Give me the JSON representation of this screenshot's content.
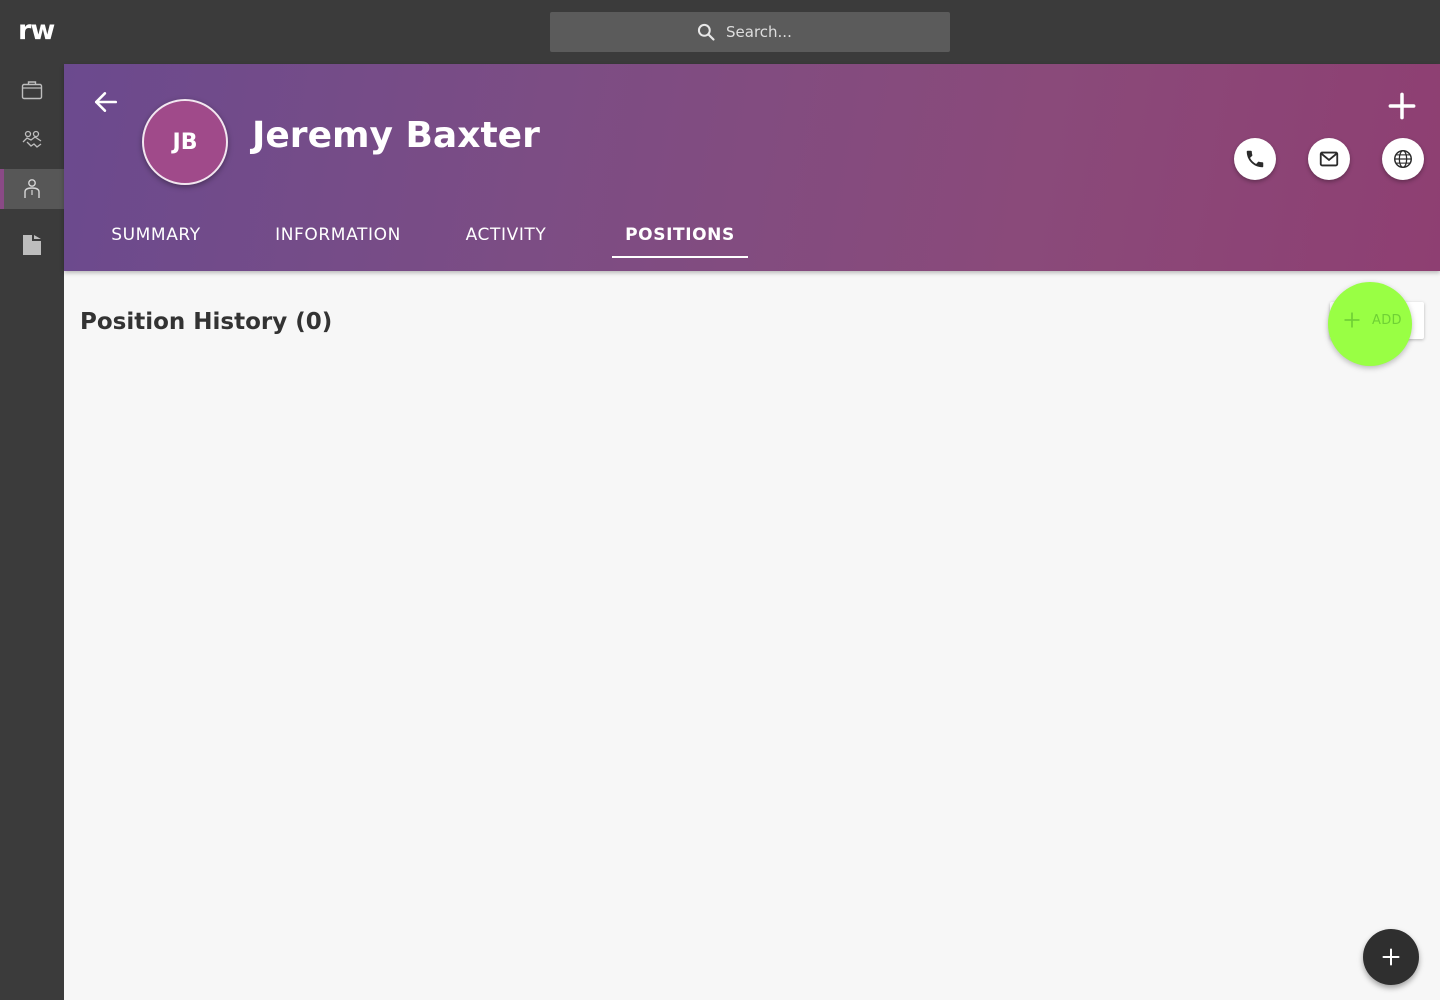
{
  "app": {
    "logo": "rw"
  },
  "search": {
    "placeholder": "Search..."
  },
  "rail": {
    "items": [
      {
        "name": "briefcase-icon",
        "active": false
      },
      {
        "name": "handshake-icon",
        "active": false
      },
      {
        "name": "person-icon",
        "active": true
      },
      {
        "name": "document-icon",
        "active": false
      }
    ]
  },
  "header": {
    "initials": "JB",
    "name": "Jeremy Baxter",
    "tabs": [
      {
        "label": "SUMMARY",
        "active": false
      },
      {
        "label": "INFORMATION",
        "active": false
      },
      {
        "label": "ACTIVITY",
        "active": false
      },
      {
        "label": "POSITIONS",
        "active": true
      }
    ]
  },
  "content": {
    "section_title": "Position History (0)",
    "add_label": "ADD"
  },
  "colors": {
    "topbar": "#3b3b3b",
    "header_start": "#6b4a8e",
    "header_end": "#8e3f72",
    "avatar": "#a04a8a",
    "add_highlight": "#99ff44"
  }
}
